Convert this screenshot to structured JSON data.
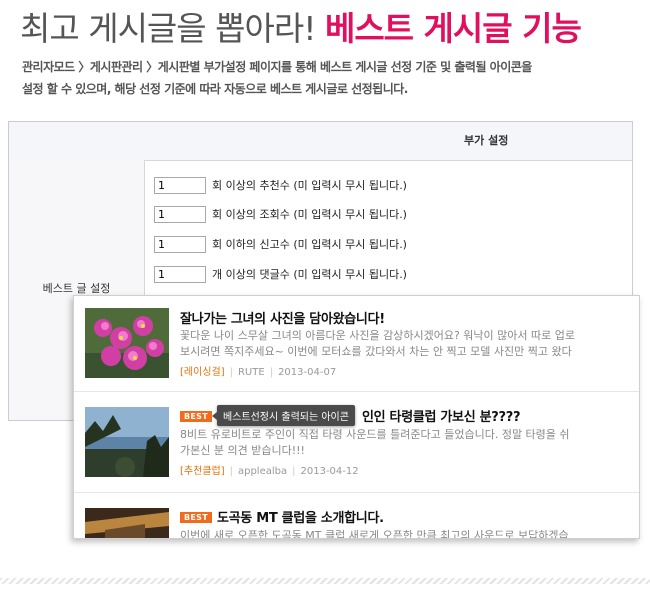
{
  "header": {
    "title_plain": "최고 게시글을 뽑아라!",
    "title_accent": "베스트 게시글 기능",
    "desc_line1": "관리자모드 〉게시판관리 〉게시판별 부가설정 페이지를 통해 베스트 게시글 선정 기준 및 출력될 아이콘을",
    "desc_line2": "설정 할 수 있으며, 해당 선정 기준에 따라 자동으로 베스트 게시글로 선정됩니다."
  },
  "panel": {
    "heading": "부가 설정",
    "row_label": "베스트 글 설정",
    "options": [
      {
        "value": "1",
        "text": "회 이상의 추천수 (미 입력시 무시 됩니다.)"
      },
      {
        "value": "1",
        "text": "회 이상의 조회수 (미 입력시 무시 됩니다.)"
      },
      {
        "value": "1",
        "text": "회 이하의 신고수 (미 입력시 무시 됩니다.)"
      },
      {
        "value": "1",
        "text": "개 이상의 댓글수 (미 입력시 무시 됩니다.)"
      }
    ]
  },
  "posts": [
    {
      "title": "잘나가는 그녀의 사진을 담아왔습니다!",
      "body_line1": "꽃다운 나이 스무살 그녀의 아름다운 사진을 감상하시겠어요? 워낙이 많아서 따로 업로",
      "body_line2": "보시려면 쪽지주세요~ 이번에 모터쇼를 갔다와서 차는 안 찍고 모델 사진만 찍고 왔다",
      "category": "[레이싱걸]",
      "author": "RUTE",
      "date": "2013-04-07"
    },
    {
      "badge": "BEST",
      "title": "베스트선정시 출력되는 아이콘 인인 타령클럽 가보신 분????",
      "title_visible": "인인 타령클럽 가보신 분????",
      "body_line1": "8비트 유로비트로 주인이 직접 타령 사운드를 틀려준다고 들었습니다. 정말 타령을 쉬",
      "body_line2": "가본신 분 의견 받습니다!!!",
      "category": "[추천클럽]",
      "author": "applealba",
      "date": "2013-04-12"
    },
    {
      "badge": "BEST",
      "title": "도곡동 MT 클럽을 소개합니다.",
      "body_line1": "이번에 새로 오픈한 도곡동 MT 클럽 새로게 오픈한 만큼 최고의 사운드로 보답하겠습"
    }
  ],
  "tooltip": "베스트선정시 출력되는 아이콘",
  "colors": {
    "accent": "#e0105f",
    "badge": "#f26b1d",
    "category": "#e5720a"
  }
}
